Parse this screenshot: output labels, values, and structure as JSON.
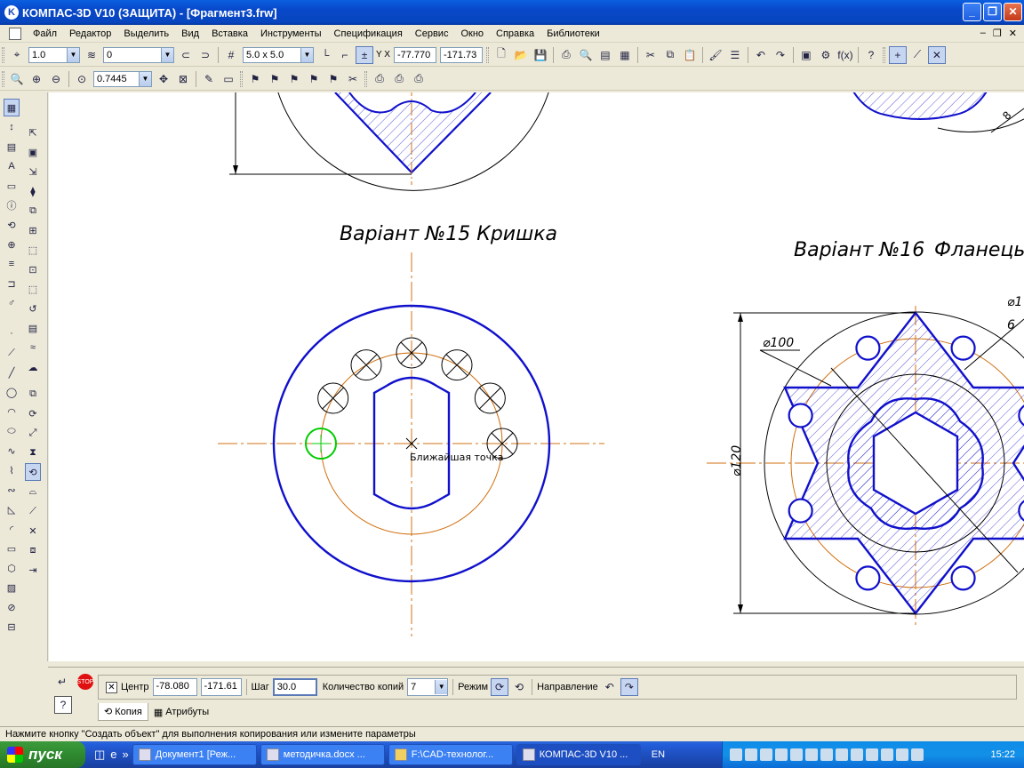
{
  "window": {
    "title": "КОМПАС-3D V10 (ЗАЩИТА) - [Фрагмент3.frw]",
    "app_icon": "kompas-logo-icon"
  },
  "menu": [
    "Файл",
    "Редактор",
    "Выделить",
    "Вид",
    "Вставка",
    "Инструменты",
    "Спецификация",
    "Сервис",
    "Окно",
    "Справка",
    "Библиотеки"
  ],
  "toolbar": {
    "line_scale": "1.0",
    "layer": "0",
    "grid_step": "5.0 x 5.0",
    "coord_x": "-77.770",
    "coord_y": "-171.73",
    "zoom": "0.7445"
  },
  "drawing": {
    "title_15": "Варіант №15 Кришка",
    "title_16": "Варіант №16",
    "title_16b": "Фланець",
    "snap_hint": "Ближайшая точка",
    "dim_100": "⌀100",
    "dim_120": "⌀120",
    "dim_8": "8",
    "dim_1": "⌀1",
    "dim_6": "6"
  },
  "colors": {
    "contour": "#1010cc",
    "axis": "#d07010",
    "hatch": "#1010cc",
    "highlight": "#00cc00"
  },
  "props": {
    "center_label": "Центр",
    "center_x": "-78.080",
    "center_y": "-171.61",
    "step_label": "Шаг",
    "step_value": "30.0",
    "copies_label": "Количество копий",
    "copies_value": "7",
    "mode_label": "Режим",
    "direction_label": "Направление",
    "tab_copy": "Копия",
    "tab_attrs": "Атрибуты"
  },
  "status": "Нажмите кнопку \"Создать объект\" для выполнения копирования или измените параметры",
  "taskbar": {
    "start": "пуск",
    "tasks": [
      "Документ1 [Реж...",
      "методичка.docx ...",
      "F:\\CAD-технолог...",
      "КОМПАС-3D V10 ..."
    ],
    "lang": "EN",
    "clock": "15:22"
  }
}
